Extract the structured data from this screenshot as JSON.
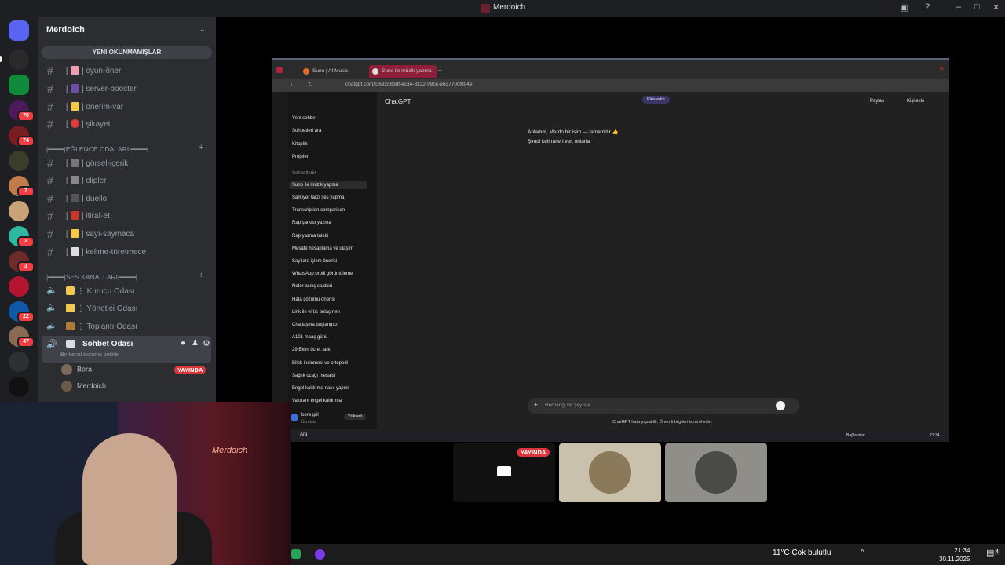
{
  "window": {
    "title": "Merdoich"
  },
  "server_rail": {
    "badges": [
      "70",
      "74",
      "7",
      "2",
      "3",
      "22",
      "47"
    ]
  },
  "sidebar": {
    "server_name": "Merdoich",
    "unread_bar": "YENİ OKUNMAMIŞLAR",
    "text_channels": [
      {
        "label": "oyun-öneri"
      },
      {
        "label": "server-booster"
      },
      {
        "label": "önerim-var"
      },
      {
        "label": "şikayet"
      }
    ],
    "category_fun": "|━━━━|EĞLENCE ODALARI|━━━━|",
    "fun_channels": [
      {
        "label": "görsel-içerik"
      },
      {
        "label": "clipler"
      },
      {
        "label": "duello"
      },
      {
        "label": "itiraf-et"
      },
      {
        "label": "sayı-saymaca"
      },
      {
        "label": "kelime-türetmece"
      }
    ],
    "category_voice": "|━━━━|SES KANALLARI|━━━━|",
    "voice_channels": [
      {
        "label": "Kurucu Odası"
      },
      {
        "label": "Yönetici Odası"
      },
      {
        "label": "Toplantı Odası"
      }
    ],
    "active_voice": {
      "label": "Sohbet Odası",
      "status": "Bir kanal durumu belirle"
    },
    "members": [
      {
        "name": "Bora",
        "live": "YAYINDA"
      },
      {
        "name": "Merdoich"
      }
    ]
  },
  "shared_screen": {
    "tabs": [
      "Suno | AI Music",
      "Suno ile müzik yapma"
    ],
    "url": "chatgpt.com/c/692c8ddf-ec34-8332-99ce-e63770cf894e",
    "chatgpt": {
      "model": "ChatGPT",
      "plus_button": "Plus edin",
      "share": "Paylaş",
      "add_person": "Kişi ekle",
      "nav": [
        "Yeni sohbet",
        "Sohbetleri ara",
        "Kitaplık",
        "Projeler"
      ],
      "section": "Sohbetlerin",
      "chats": [
        "Suno ile müzik yapma",
        "Şarkıyer tarzı ses yapma",
        "Transcription comparison",
        "Rap şarkısı yazma",
        "Rap yazma talebi",
        "Mesafe hesaplama ve ulaşım",
        "Sayılara işlem önerisi",
        "WhatsApp profil görüntüleme",
        "Noter açılış saatleri",
        "Hata çözümü önerisi",
        "Link ile virüs bulaşır mı",
        "Chatlaşma başlangıcı",
        "A101 maaş günü",
        "29 Ekim ücret farkı",
        "Bilek incinmesi ve ortopedi",
        "Sağlık ocağı mesaisi",
        "Engel kaldırma nasıl yapılır",
        "Valorant engel kaldırma"
      ],
      "messages": [
        "Anladım, Merdo bir isim — tamamdır 👍",
        "Şimdi kelimeleri ver, onlarla"
      ],
      "user": {
        "name": "bora göl",
        "plan": "Ücretsiz",
        "upgrade": "Yükselt"
      },
      "input_placeholder": "Herhangi bir şey sor",
      "footer": "ChatGPT hata yapabilir. Önemli bilgileri kontrol edin.",
      "search": "Ara",
      "connected": "Bağlantılar",
      "time": "21:34"
    }
  },
  "tiles": {
    "live": "YAYINDA"
  },
  "webcam": {
    "logo": "Merdoich"
  },
  "taskbar": {
    "weather": "11°C  Çok bulutlu",
    "time": "21:34",
    "date": "30.11.2025",
    "notifications": "4"
  },
  "colors": {
    "accent_live": "#da373c",
    "sidebar_bg": "#2b2d31",
    "rail_bg": "#1e1f22"
  }
}
